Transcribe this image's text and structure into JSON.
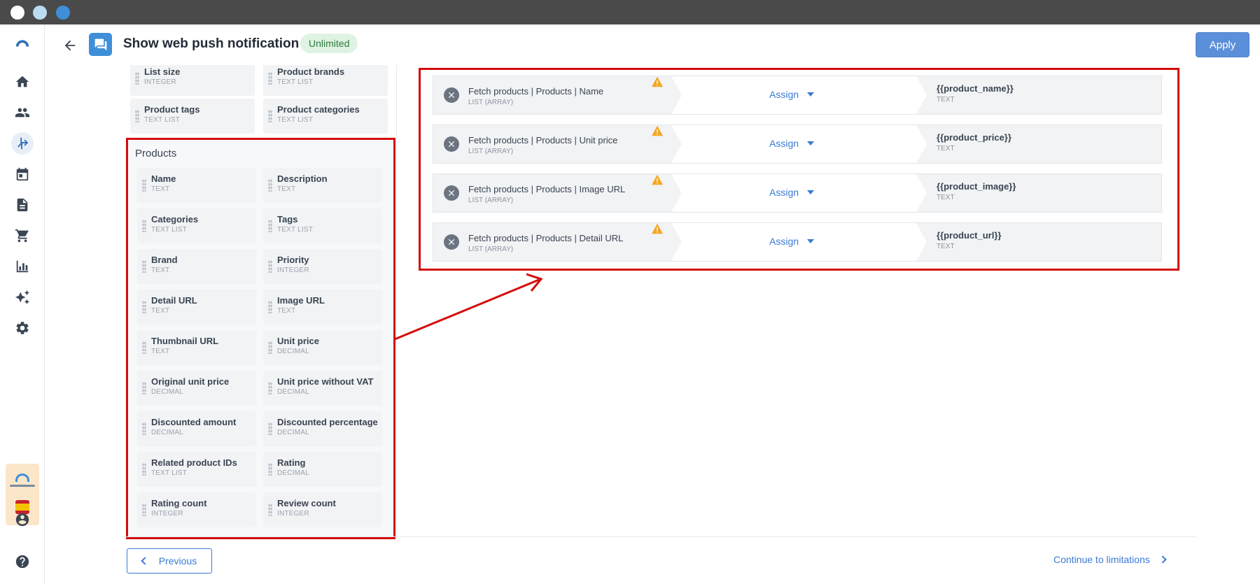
{
  "header": {
    "title": "Show web push notification",
    "badge": "Unlimited",
    "apply_label": "Apply"
  },
  "rail": {
    "items": [
      "home-icon",
      "contacts-icon",
      "scenarios-icon",
      "calendar-icon",
      "documents-icon",
      "cart-icon",
      "analytics-icon",
      "ai-sparkle-icon",
      "settings-icon"
    ],
    "bottom": [
      "account-icon",
      "help-icon"
    ]
  },
  "top_fields": [
    {
      "name": "List size",
      "type": "INTEGER"
    },
    {
      "name": "Product brands",
      "type": "TEXT LIST"
    },
    {
      "name": "Product tags",
      "type": "TEXT LIST"
    },
    {
      "name": "Product categories",
      "type": "TEXT LIST"
    }
  ],
  "products": {
    "title": "Products",
    "fields": [
      {
        "name": "Name",
        "type": "TEXT"
      },
      {
        "name": "Description",
        "type": "TEXT"
      },
      {
        "name": "Categories",
        "type": "TEXT LIST"
      },
      {
        "name": "Tags",
        "type": "TEXT LIST"
      },
      {
        "name": "Brand",
        "type": "TEXT"
      },
      {
        "name": "Priority",
        "type": "INTEGER"
      },
      {
        "name": "Detail URL",
        "type": "TEXT"
      },
      {
        "name": "Image URL",
        "type": "TEXT"
      },
      {
        "name": "Thumbnail URL",
        "type": "TEXT"
      },
      {
        "name": "Unit price",
        "type": "DECIMAL"
      },
      {
        "name": "Original unit price",
        "type": "DECIMAL"
      },
      {
        "name": "Unit price without VAT",
        "type": "DECIMAL"
      },
      {
        "name": "Discounted amount",
        "type": "DECIMAL"
      },
      {
        "name": "Discounted percentage",
        "type": "DECIMAL"
      },
      {
        "name": "Related product IDs",
        "type": "TEXT LIST"
      },
      {
        "name": "Rating",
        "type": "DECIMAL"
      },
      {
        "name": "Rating count",
        "type": "INTEGER"
      },
      {
        "name": "Review count",
        "type": "INTEGER"
      }
    ]
  },
  "mappings": [
    {
      "source": "Fetch products | Products | Name",
      "source_type": "LIST (ARRAY)",
      "action": "Assign",
      "target": "{{product_name}}",
      "target_type": "TEXT"
    },
    {
      "source": "Fetch products | Products | Unit price",
      "source_type": "LIST (ARRAY)",
      "action": "Assign",
      "target": "{{product_price}}",
      "target_type": "TEXT"
    },
    {
      "source": "Fetch products | Products | Image URL",
      "source_type": "LIST (ARRAY)",
      "action": "Assign",
      "target": "{{product_image}}",
      "target_type": "TEXT"
    },
    {
      "source": "Fetch products | Products | Detail URL",
      "source_type": "LIST (ARRAY)",
      "action": "Assign",
      "target": "{{product_url}}",
      "target_type": "TEXT"
    }
  ],
  "footer": {
    "previous_label": "Previous",
    "next_label": "Continue to limitations"
  },
  "colors": {
    "accent": "#3a7bd5",
    "highlight": "#d40c0c",
    "warning": "#f5a623"
  }
}
